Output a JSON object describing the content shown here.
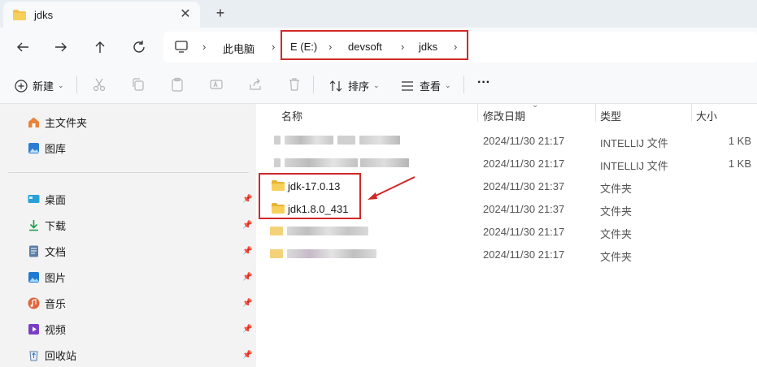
{
  "tab": {
    "title": "jdks",
    "close": "✕",
    "new": "+"
  },
  "address": {
    "crumbs": [
      "此电脑",
      "E (E:)",
      "devsoft",
      "jdks"
    ],
    "separator": "›"
  },
  "toolbar": {
    "new_label": "新建",
    "sort_label": "排序",
    "view_label": "查看",
    "more_label": "···",
    "caret": "⌄"
  },
  "sidebar": {
    "home": "主文件夹",
    "gallery": "图库",
    "desktop": "桌面",
    "downloads": "下载",
    "documents": "文档",
    "pictures": "图片",
    "music": "音乐",
    "videos": "视频",
    "recycle": "回收站"
  },
  "columns": {
    "name": "名称",
    "modified": "修改日期",
    "type": "类型",
    "size": "大小"
  },
  "rows": [
    {
      "name": "",
      "date": "2024/11/30 21:17",
      "type": "INTELLIJ 文件",
      "size": "1 KB",
      "blurred": true
    },
    {
      "name": "",
      "date": "2024/11/30 21:17",
      "type": "INTELLIJ 文件",
      "size": "1 KB",
      "blurred": true
    },
    {
      "name": "jdk-17.0.13",
      "date": "2024/11/30 21:37",
      "type": "文件夹",
      "size": "",
      "blurred": false
    },
    {
      "name": "jdk1.8.0_431",
      "date": "2024/11/30 21:37",
      "type": "文件夹",
      "size": "",
      "blurred": false
    },
    {
      "name": "",
      "date": "2024/11/30 21:17",
      "type": "文件夹",
      "size": "",
      "blurred": true
    },
    {
      "name": "",
      "date": "2024/11/30 21:17",
      "type": "文件夹",
      "size": "",
      "blurred": true
    }
  ],
  "colors": {
    "annotation": "#d12828",
    "folder": "#f2c14e",
    "accent": "#0067c0"
  }
}
